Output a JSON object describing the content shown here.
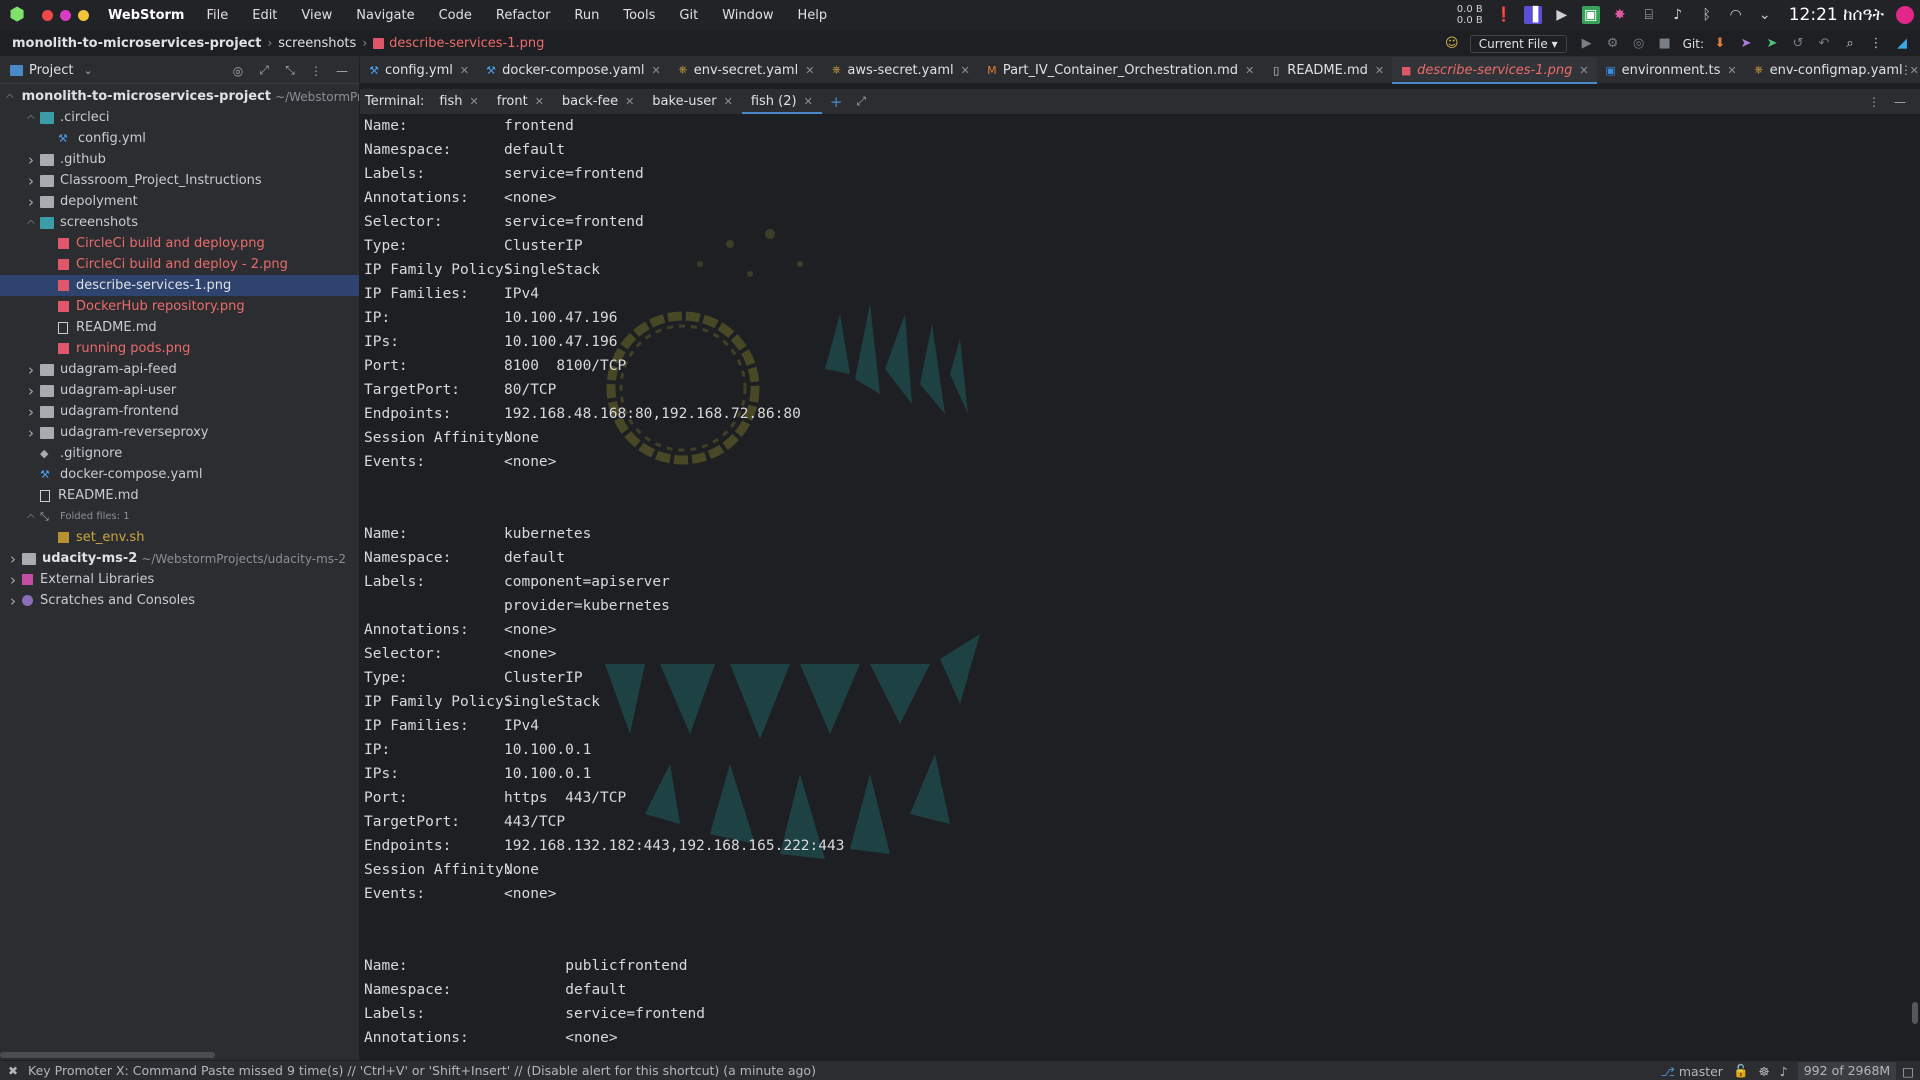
{
  "menubar": {
    "app_name": "WebStorm",
    "items": [
      "File",
      "Edit",
      "View",
      "Navigate",
      "Code",
      "Refactor",
      "Run",
      "Tools",
      "Git",
      "Window",
      "Help"
    ],
    "net_up": "0.0 B",
    "net_down": "0.0 B",
    "clock": "12:21 ከሰዓት",
    "window_controls": [
      "#f04848",
      "#d93cc3",
      "#f3c43b"
    ]
  },
  "navbar": {
    "crumbs": [
      "monolith-to-microservices-project",
      "screenshots",
      "describe-services-1.png"
    ],
    "run_config": "Current File",
    "git_label": "Git:"
  },
  "project": {
    "title": "Project",
    "tree": [
      {
        "label": "monolith-to-microservices-project",
        "suffix": "~/WebstormProje",
        "depth": 0,
        "chev": "v",
        "icon": "folder",
        "style": "bold"
      },
      {
        "label": ".circleci",
        "depth": 1,
        "chev": "v",
        "icon": "folder-teal",
        "style": ""
      },
      {
        "label": "config.yml",
        "depth": 2,
        "chev": "",
        "icon": "yaml",
        "style": ""
      },
      {
        "label": ".github",
        "depth": 1,
        "chev": ">",
        "icon": "folder",
        "style": ""
      },
      {
        "label": "Classroom_Project_Instructions",
        "depth": 1,
        "chev": ">",
        "icon": "folder",
        "style": ""
      },
      {
        "label": "depolyment",
        "depth": 1,
        "chev": ">",
        "icon": "folder",
        "style": ""
      },
      {
        "label": "screenshots",
        "depth": 1,
        "chev": "v",
        "icon": "folder-teal",
        "style": ""
      },
      {
        "label": "CircleCi build and deploy.png",
        "depth": 2,
        "chev": "",
        "icon": "png",
        "style": "red"
      },
      {
        "label": "CircleCi build and deploy - 2.png",
        "depth": 2,
        "chev": "",
        "icon": "png",
        "style": "red"
      },
      {
        "label": "describe-services-1.png",
        "depth": 2,
        "chev": "",
        "icon": "png",
        "style": "selected"
      },
      {
        "label": "DockerHub repository.png",
        "depth": 2,
        "chev": "",
        "icon": "png",
        "style": "red"
      },
      {
        "label": "README.md",
        "depth": 2,
        "chev": "",
        "icon": "md",
        "style": ""
      },
      {
        "label": "running pods.png",
        "depth": 2,
        "chev": "",
        "icon": "png",
        "style": "red"
      },
      {
        "label": "udagram-api-feed",
        "depth": 1,
        "chev": ">",
        "icon": "folder",
        "style": ""
      },
      {
        "label": "udagram-api-user",
        "depth": 1,
        "chev": ">",
        "icon": "folder",
        "style": ""
      },
      {
        "label": "udagram-frontend",
        "depth": 1,
        "chev": ">",
        "icon": "folder",
        "style": ""
      },
      {
        "label": "udagram-reverseproxy",
        "depth": 1,
        "chev": ">",
        "icon": "folder",
        "style": ""
      },
      {
        "label": ".gitignore",
        "depth": 1,
        "chev": "",
        "icon": "gear",
        "style": ""
      },
      {
        "label": "docker-compose.yaml",
        "depth": 1,
        "chev": "",
        "icon": "yaml",
        "style": ""
      },
      {
        "label": "README.md",
        "depth": 1,
        "chev": "",
        "icon": "md",
        "style": ""
      },
      {
        "label": "Folded files: 1",
        "depth": 1,
        "chev": "v",
        "icon": "fold",
        "style": "small"
      },
      {
        "label": "set_env.sh",
        "depth": 2,
        "chev": "",
        "icon": "sh",
        "style": "yellow"
      },
      {
        "label": "udacity-ms-2",
        "suffix": "~/WebstormProjects/udacity-ms-2",
        "depth": 0,
        "chev": ">",
        "icon": "folder",
        "style": "bold"
      },
      {
        "label": "External Libraries",
        "depth": 0,
        "chev": ">",
        "icon": "lib",
        "style": ""
      },
      {
        "label": "Scratches and Consoles",
        "depth": 0,
        "chev": ">",
        "icon": "scratch",
        "style": ""
      }
    ]
  },
  "editor_tabs": [
    {
      "label": "config.yml",
      "icon": "yaml",
      "active": false
    },
    {
      "label": "docker-compose.yaml",
      "icon": "yaml",
      "active": false
    },
    {
      "label": "env-secret.yaml",
      "icon": "k8s",
      "active": false
    },
    {
      "label": "aws-secret.yaml",
      "icon": "k8s",
      "active": false
    },
    {
      "label": "Part_IV_Container_Orchestration.md",
      "icon": "md-orange",
      "active": false
    },
    {
      "label": "README.md",
      "icon": "md",
      "active": false
    },
    {
      "label": "describe-services-1.png",
      "icon": "png",
      "active": true
    },
    {
      "label": "environment.ts",
      "icon": "ts",
      "active": false
    },
    {
      "label": "env-configmap.yaml",
      "icon": "k8s",
      "active": false
    }
  ],
  "terminal": {
    "label": "Terminal:",
    "tabs": [
      {
        "label": "fish",
        "active": false
      },
      {
        "label": "front",
        "active": false
      },
      {
        "label": "back-fee",
        "active": false
      },
      {
        "label": "bake-user",
        "active": false
      },
      {
        "label": "fish (2)",
        "active": true
      }
    ],
    "lines": [
      {
        "k": "Name:",
        "v": "frontend",
        "col": 1
      },
      {
        "k": "Namespace:",
        "v": "default",
        "col": 1
      },
      {
        "k": "Labels:",
        "v": "service=frontend",
        "col": 1
      },
      {
        "k": "Annotations:",
        "v": "<none>",
        "col": 1
      },
      {
        "k": "Selector:",
        "v": "service=frontend",
        "col": 1
      },
      {
        "k": "Type:",
        "v": "ClusterIP",
        "col": 1
      },
      {
        "k": "IP Family Policy:",
        "v": "SingleStack",
        "col": 1
      },
      {
        "k": "IP Families:",
        "v": "IPv4",
        "col": 1
      },
      {
        "k": "IP:",
        "v": "10.100.47.196",
        "col": 1
      },
      {
        "k": "IPs:",
        "v": "10.100.47.196",
        "col": 1
      },
      {
        "k": "Port:",
        "v": "8100  8100/TCP",
        "col": 1
      },
      {
        "k": "TargetPort:",
        "v": "80/TCP",
        "col": 1
      },
      {
        "k": "Endpoints:",
        "v": "192.168.48.168:80,192.168.72.86:80",
        "col": 1
      },
      {
        "k": "Session Affinity:",
        "v": "None",
        "col": 1
      },
      {
        "k": "Events:",
        "v": "<none>",
        "col": 1
      },
      {
        "k": "",
        "v": "",
        "col": 1
      },
      {
        "k": "",
        "v": "",
        "col": 1
      },
      {
        "k": "Name:",
        "v": "kubernetes",
        "col": 1
      },
      {
        "k": "Namespace:",
        "v": "default",
        "col": 1
      },
      {
        "k": "Labels:",
        "v": "component=apiserver",
        "col": 1
      },
      {
        "k": "",
        "v": "provider=kubernetes",
        "col": 1
      },
      {
        "k": "Annotations:",
        "v": "<none>",
        "col": 1
      },
      {
        "k": "Selector:",
        "v": "<none>",
        "col": 1
      },
      {
        "k": "Type:",
        "v": "ClusterIP",
        "col": 1
      },
      {
        "k": "IP Family Policy:",
        "v": "SingleStack",
        "col": 1
      },
      {
        "k": "IP Families:",
        "v": "IPv4",
        "col": 1
      },
      {
        "k": "IP:",
        "v": "10.100.0.1",
        "col": 1
      },
      {
        "k": "IPs:",
        "v": "10.100.0.1",
        "col": 1
      },
      {
        "k": "Port:",
        "v": "https  443/TCP",
        "col": 1
      },
      {
        "k": "TargetPort:",
        "v": "443/TCP",
        "col": 1
      },
      {
        "k": "Endpoints:",
        "v": "192.168.132.182:443,192.168.165.222:443",
        "col": 1
      },
      {
        "k": "Session Affinity:",
        "v": "None",
        "col": 1
      },
      {
        "k": "Events:",
        "v": "<none>",
        "col": 1
      },
      {
        "k": "",
        "v": "",
        "col": 1
      },
      {
        "k": "",
        "v": "",
        "col": 1
      },
      {
        "k": "Name:",
        "v": "publicfrontend",
        "col": 2
      },
      {
        "k": "Namespace:",
        "v": "default",
        "col": 2
      },
      {
        "k": "Labels:",
        "v": "service=frontend",
        "col": 2
      },
      {
        "k": "Annotations:",
        "v": "<none>",
        "col": 2
      }
    ]
  },
  "statusbar": {
    "message": "Key Promoter X: Command Paste missed 9 time(s) // 'Ctrl+V' or 'Shift+Insert' // (Disable alert for this shortcut) (a minute ago)",
    "branch": "master",
    "memory": "992 of 2968M"
  }
}
